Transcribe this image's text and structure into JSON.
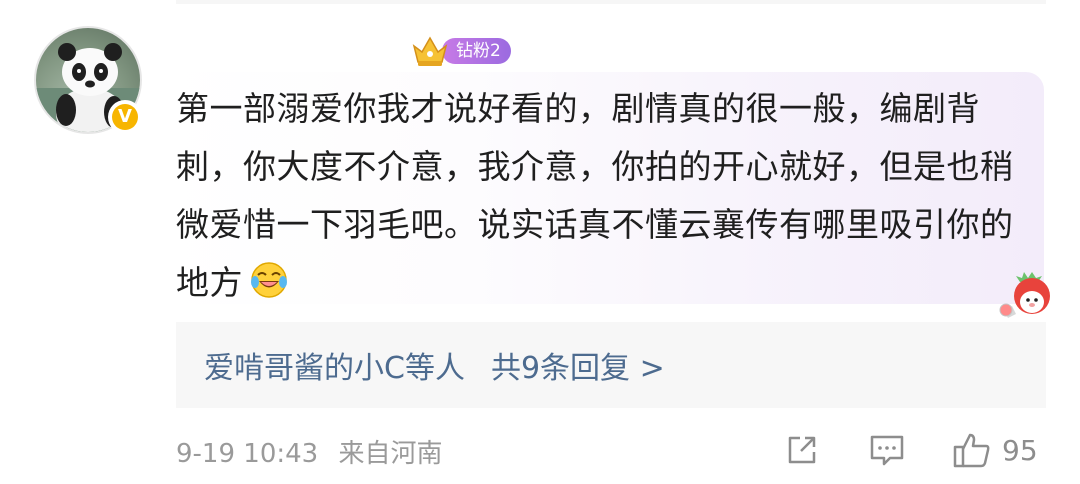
{
  "comment": {
    "fan_badge": "钻粉2",
    "verified_badge": "V",
    "text": "第一部溺爱你我才说好看的，剧情真的很一般，编剧背刺，你大度不介意，我介意，你拍的开心就好，但是也稍微爱惜一下羽毛吧。说实话真不懂云襄传有哪里吸引你的地方",
    "emoji": "laughing-crying-emoji",
    "replies": {
      "users": "爱啃哥酱的小C等人",
      "count_label": "共9条回复 >"
    },
    "time": "9-19 10:43",
    "location": "来自河南",
    "likes": "95"
  },
  "colors": {
    "reply_link": "#4d6b8f",
    "meta_gray": "#9a9a9a",
    "badge_purple": "#9b6be0",
    "verified_yellow": "#f7b500"
  },
  "icons": [
    "avatar-panda",
    "crown-icon",
    "share-icon",
    "comment-icon",
    "like-icon",
    "strawberry-sticker"
  ]
}
